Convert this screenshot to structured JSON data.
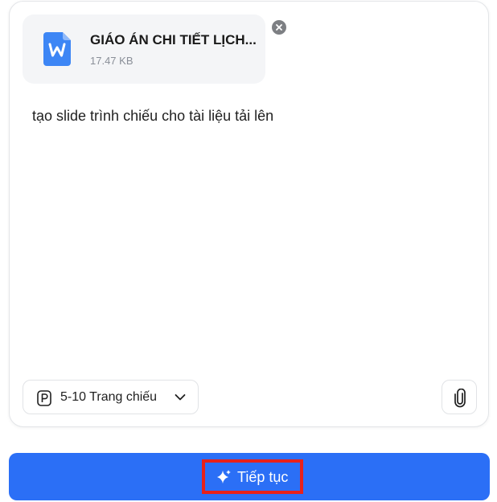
{
  "attachment": {
    "file_name": "GIÁO ÁN CHI TIẾT LỊCH...",
    "file_size": "17.47 KB",
    "file_type_icon": "word-document-icon",
    "icon_color": "#3d86f5"
  },
  "prompt": {
    "text": "tạo slide trình chiếu cho tài liệu tải lên"
  },
  "toolbar": {
    "pages_label": "5-10 Trang chiếu"
  },
  "action": {
    "continue_label": "Tiếp tục",
    "button_color": "#2b6ff6",
    "highlight_color": "#e8211a"
  }
}
